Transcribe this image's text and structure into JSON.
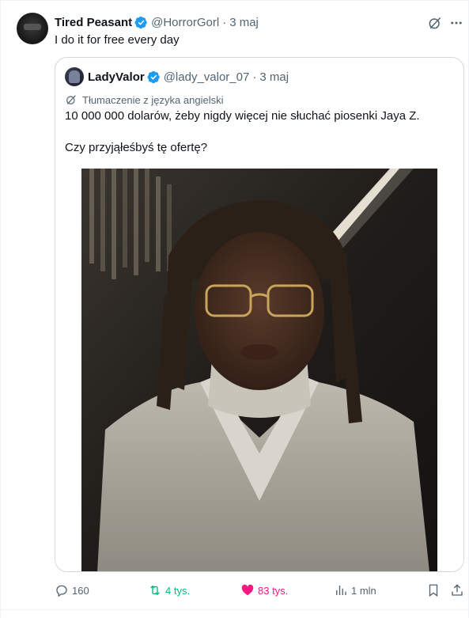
{
  "tweet": {
    "author_name": "Tired Peasant",
    "author_handle": "@HorrorGorl",
    "separator": "·",
    "date": "3 maj",
    "text": "I do it for free every day",
    "verified": true
  },
  "quoted_tweet": {
    "author_name": "LadyValor",
    "author_handle": "@lady_valor_07",
    "separator": "·",
    "date": "3 maj",
    "verified": true,
    "translation_label": "Tłumaczenie z języka angielski",
    "text_line1": "10 000 000 dolarów, żeby nigdy więcej nie słuchać piosenki Jaya Z.",
    "text_line2": "Czy przyjąłeśbyś tę ofertę?"
  },
  "actions": {
    "replies": "160",
    "reposts": "4 tys.",
    "likes": "83 tys.",
    "views": "1 mln"
  },
  "colors": {
    "verified_blue": "#1d9bf0",
    "repost_green": "#00ba7c",
    "like_pink": "#f91880",
    "secondary_text": "#536471",
    "border": "#cfd9de"
  },
  "icons": {
    "more": "more-icon",
    "grok": "grok-icon",
    "reply": "reply-icon",
    "repost": "repost-icon",
    "like": "heart-icon",
    "views": "views-icon",
    "bookmark": "bookmark-icon",
    "share": "share-icon",
    "translate": "translate-icon"
  }
}
